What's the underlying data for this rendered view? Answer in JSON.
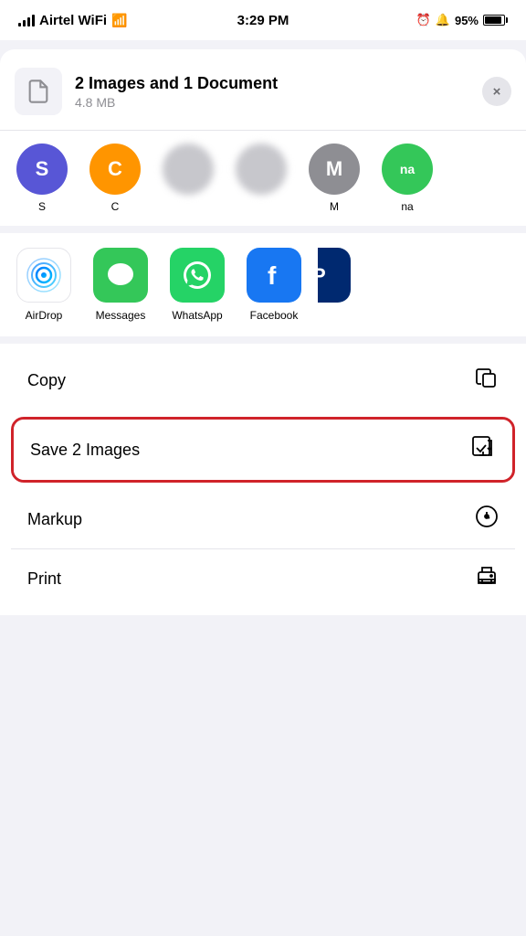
{
  "statusBar": {
    "carrier": "Airtel WiFi",
    "time": "3:29 PM",
    "battery": "95%"
  },
  "shareHeader": {
    "title": "2 Images and 1 Document",
    "subtitle": "4.8 MB",
    "closeLabel": "×"
  },
  "contacts": [
    {
      "id": "c1",
      "name": "S",
      "initial": "S",
      "color": "#5856d6"
    },
    {
      "id": "c2",
      "name": "C",
      "initial": "C",
      "color": "#ff9500"
    },
    {
      "id": "c3",
      "name": "",
      "initial": "",
      "color": "#c7c7cc"
    },
    {
      "id": "c4",
      "name": "",
      "initial": "",
      "color": "#c7c7cc"
    },
    {
      "id": "c5",
      "name": "M",
      "initial": "M",
      "color": "#ff3b30"
    },
    {
      "id": "c6",
      "name": "na",
      "initial": "na",
      "color": "#34c759"
    }
  ],
  "apps": [
    {
      "id": "airdrop",
      "label": "AirDrop"
    },
    {
      "id": "messages",
      "label": "Messages"
    },
    {
      "id": "whatsapp",
      "label": "WhatsApp"
    },
    {
      "id": "facebook",
      "label": "Facebook"
    },
    {
      "id": "paytm",
      "label": "P"
    }
  ],
  "actions": [
    {
      "id": "copy",
      "label": "Copy",
      "icon": "copy",
      "highlighted": false
    },
    {
      "id": "save-images",
      "label": "Save 2 Images",
      "icon": "save",
      "highlighted": true
    },
    {
      "id": "markup",
      "label": "Markup",
      "icon": "markup",
      "highlighted": false
    },
    {
      "id": "print",
      "label": "Print",
      "icon": "print",
      "highlighted": false
    }
  ]
}
